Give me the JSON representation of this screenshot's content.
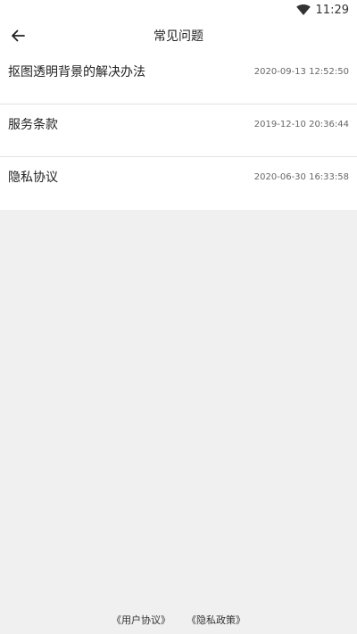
{
  "status_bar": {
    "time": "11:29",
    "wifi_icon": "wifi-icon"
  },
  "header": {
    "title": "常见问题",
    "back_icon": "arrow-left-icon"
  },
  "faq_items": [
    {
      "title": "抠图透明背景的解决办法",
      "date": "2020-09-13 12:52:50"
    },
    {
      "title": "服务条款",
      "date": "2019-12-10 20:36:44"
    },
    {
      "title": "隐私协议",
      "date": "2020-06-30 16:33:58"
    }
  ],
  "footer": {
    "user_agreement": "《用户协议》",
    "privacy_policy": "《隐私政策》"
  }
}
